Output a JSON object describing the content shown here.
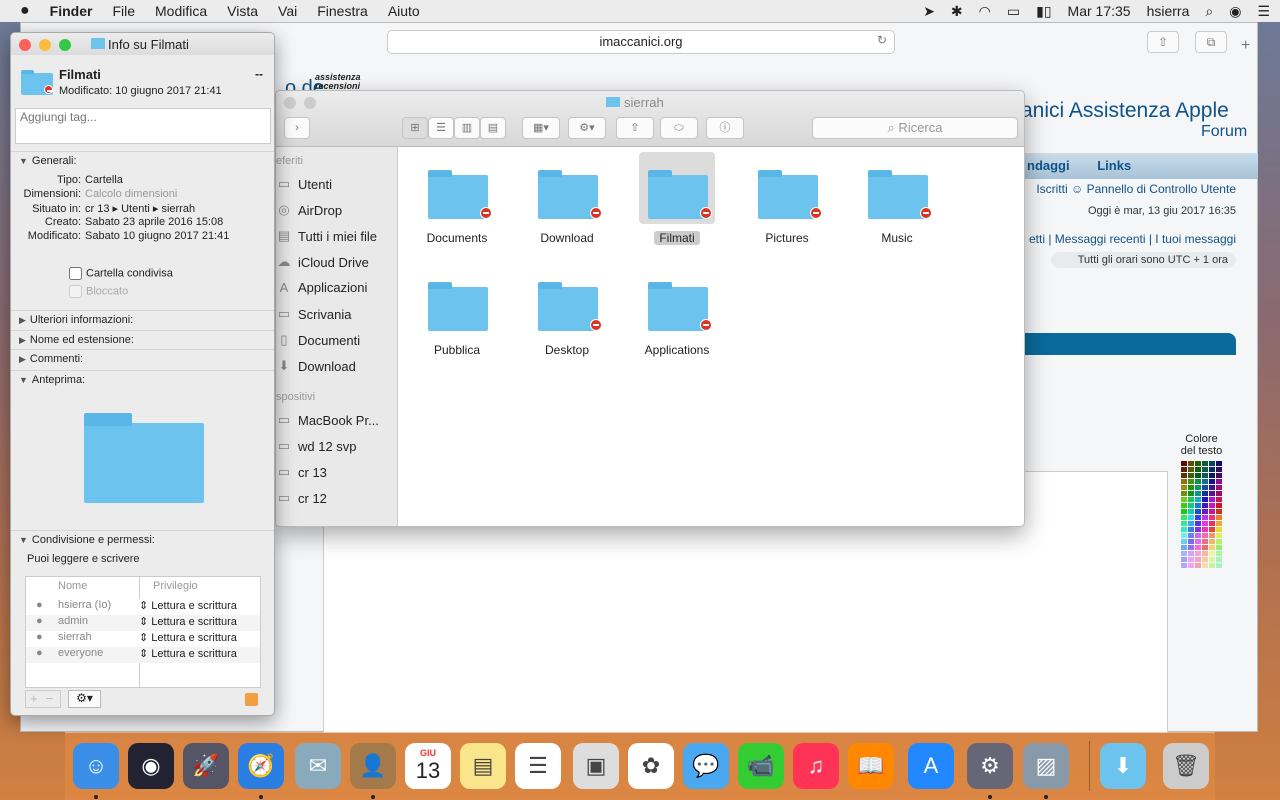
{
  "menubar": {
    "apple": "",
    "items": [
      "Finder",
      "File",
      "Modifica",
      "Vista",
      "Vai",
      "Finestra",
      "Aiuto"
    ],
    "clock": "Mar 17:35",
    "user": "hsierra"
  },
  "safari": {
    "url": "imaccanici.org",
    "forum_title": "anici Assistenza Apple",
    "forum_sub": "Forum",
    "nav": [
      "ndaggi",
      "Links"
    ],
    "line1": "Iscritti  ☺ Pannello di Controllo Utente",
    "line2": "Oggi è mar, 13 giu 2017 16:35",
    "line3": "etti | Messaggi recenti | I tuoi messaggi",
    "line4": "Tutti gli orari sono UTC + 1 ora",
    "logo_fragment": "o de",
    "logo_small": "assistenza recensioni",
    "color_label": "Colore del testo"
  },
  "info": {
    "title": "Info su Filmati",
    "name": "Filmati",
    "size": "--",
    "modified_header": "Modificato:  10 giugno 2017 21:41",
    "tags_placeholder": "Aggiungi tag...",
    "general": "Generali:",
    "fields": [
      {
        "k": "Tipo:",
        "v": "Cartella"
      },
      {
        "k": "Dimensioni:",
        "v": "Calcolo dimensioni"
      },
      {
        "k": "Situato in:",
        "v": "cr 13 ▸ Utenti ▸ sierrah"
      },
      {
        "k": "Creato:",
        "v": "Sabato 23 aprile 2016 15:08"
      },
      {
        "k": "Modificato:",
        "v": "Sabato 10 giugno 2017 21:41"
      }
    ],
    "shared_folder": "Cartella condivisa",
    "locked": "Bloccato",
    "sections": [
      "Ulteriori informazioni:",
      "Nome ed estensione:",
      "Commenti:",
      "Anteprima:"
    ],
    "sharing": "Condivisione e permessi:",
    "access": "Puoi leggere e scrivere",
    "perm_headers": [
      "Nome",
      "Privilegio"
    ],
    "perms": [
      {
        "name": "hsierra (Io)",
        "priv": "Lettura e scrittura"
      },
      {
        "name": "admin",
        "priv": "Lettura e scrittura"
      },
      {
        "name": "sierrah",
        "priv": "Lettura e scrittura"
      },
      {
        "name": "everyone",
        "priv": "Lettura e scrittura"
      }
    ]
  },
  "finder": {
    "title": "sierrah",
    "search_placeholder": "Ricerca",
    "favorites_head": "eferiti",
    "favorites": [
      "Utenti",
      "AirDrop",
      "Tutti i miei file",
      "iCloud Drive",
      "Applicazioni",
      "Scrivania",
      "Documenti",
      "Download"
    ],
    "devices_head": "spositivi",
    "devices": [
      "MacBook Pr...",
      "wd 12 svp",
      "cr 13",
      "cr 12"
    ],
    "items": [
      "Documents",
      "Download",
      "Filmati",
      "Pictures",
      "Music",
      "Pubblica",
      "Desktop",
      "Applications"
    ],
    "selected": "Filmati"
  },
  "dock": {
    "calendar_month": "GIU",
    "calendar_day": "13",
    "apps": [
      "Finder",
      "Siri",
      "Launchpad",
      "Safari",
      "Mail",
      "Contatti",
      "Calendario",
      "Note",
      "Promemoria",
      "Foto preview",
      "Foto",
      "Messaggi",
      "FaceTime",
      "iTunes",
      "iBooks",
      "App Store",
      "Preferenze di Sistema",
      "Anteprima",
      "Download",
      "Cestino"
    ]
  },
  "colors": {
    "accent": "#105289",
    "folder": "#6cc3ee",
    "badge": "#dd3322"
  }
}
